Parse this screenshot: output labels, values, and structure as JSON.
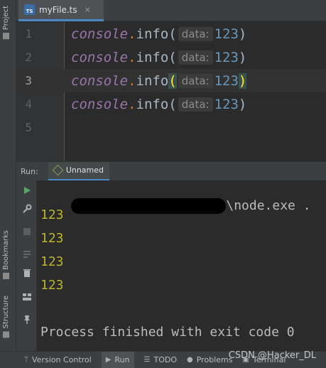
{
  "sidebar": {
    "project_label": "Project",
    "bookmarks_label": "Bookmarks",
    "structure_label": "Structure"
  },
  "tab": {
    "icon_text": "TS",
    "label": "myFile.ts",
    "close": "×"
  },
  "editor": {
    "lines": [
      {
        "num": "1",
        "obj": "console",
        "dot": ".",
        "fn": "info",
        "open": "(",
        "hint": "data:",
        "arg": "123",
        "close": ")"
      },
      {
        "num": "2",
        "obj": "console",
        "dot": ".",
        "fn": "info",
        "open": "(",
        "hint": "data:",
        "arg": "123",
        "close": ")"
      },
      {
        "num": "3",
        "obj": "console",
        "dot": ".",
        "fn": "info",
        "open": "(",
        "hint": "data:",
        "arg": "123",
        "close": ")"
      },
      {
        "num": "4",
        "obj": "console",
        "dot": ".",
        "fn": "info",
        "open": "(",
        "hint": "data:",
        "arg": "123",
        "close": ")"
      },
      {
        "num": "5"
      }
    ],
    "current_line": 3
  },
  "run_panel": {
    "label": "Run:",
    "tab_label": "Unnamed"
  },
  "console": {
    "command_suffix": "\\node.exe .",
    "outputs": [
      "123",
      "123",
      "123",
      "123"
    ],
    "finished": "Process finished with exit code 0"
  },
  "bottom_bar": {
    "version_control": "Version Control",
    "run": "Run",
    "todo": "TODO",
    "problems": "Problems",
    "terminal": "Terminal"
  },
  "watermark": "CSDN @Hacker_DL",
  "colors": {
    "keyword": "#9876aa",
    "number": "#6897bb",
    "output": "#bbb529",
    "accent": "#4a88c7"
  }
}
